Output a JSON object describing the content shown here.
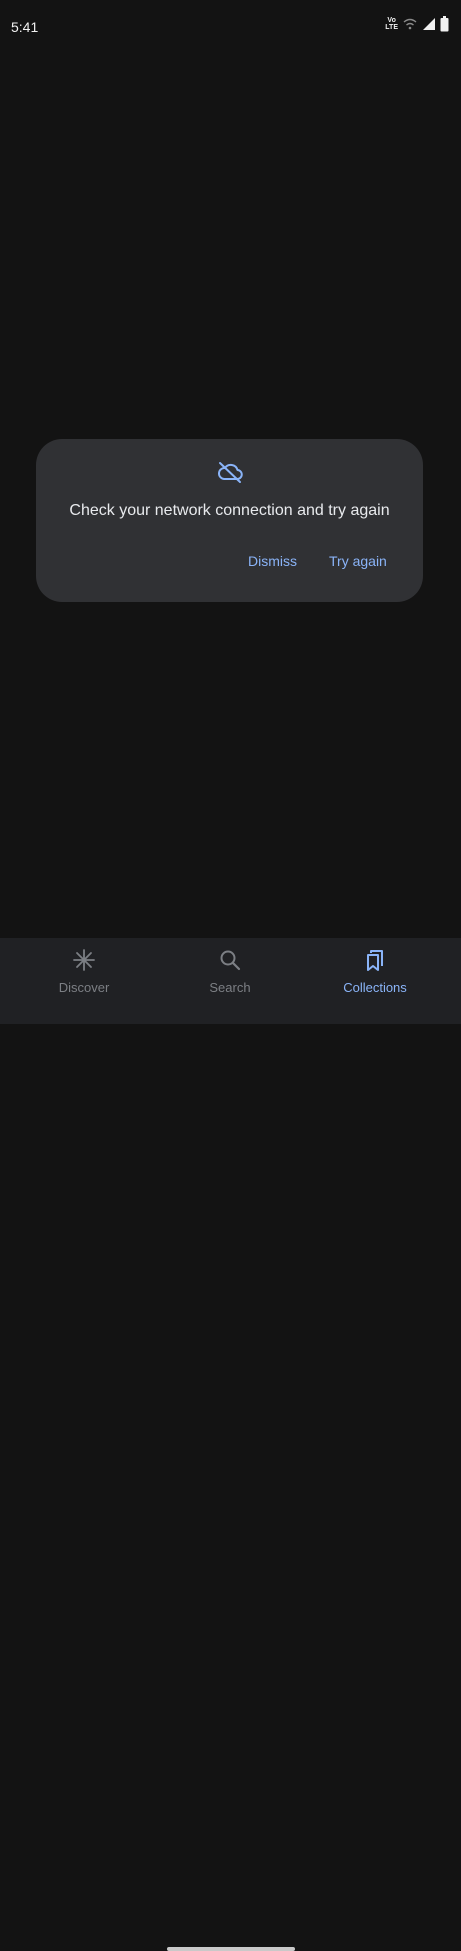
{
  "status_bar": {
    "time": "5:41",
    "volte_top": "Vo",
    "volte_bottom": "LTE"
  },
  "dialog": {
    "icon": "cloud-off-icon",
    "message": "Check your network connection and try again",
    "dismiss_label": "Dismiss",
    "try_again_label": "Try again"
  },
  "bottom_nav": {
    "items": [
      {
        "label": "Discover",
        "icon": "asterisk-icon",
        "active": false
      },
      {
        "label": "Search",
        "icon": "search-icon",
        "active": false
      },
      {
        "label": "Collections",
        "icon": "bookmarks-icon",
        "active": true
      }
    ]
  },
  "colors": {
    "background": "#131313",
    "dialog": "#303134",
    "accent": "#8ab4f8",
    "nav_background": "#202124",
    "inactive": "#7c7f84"
  }
}
